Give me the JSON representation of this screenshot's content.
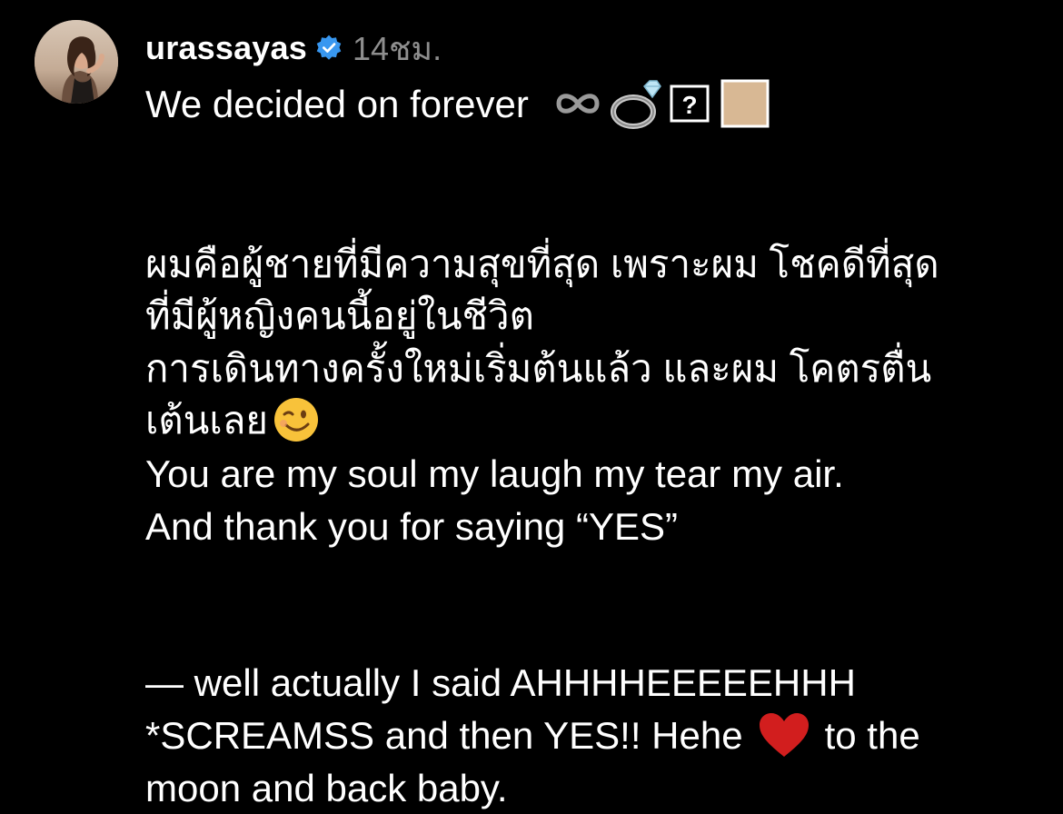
{
  "post": {
    "username": "urassayas",
    "time": "14ชม.",
    "verified_icon": "verified-badge-icon",
    "colors": {
      "background": "#000000",
      "text": "#ffffff",
      "muted": "#8e8e8e",
      "verified": "#3897f0",
      "heart": "#d21e1e"
    }
  },
  "caption": {
    "line1": "We decided on forever",
    "para2_line1": "ผมคือผู้ชายที่มีความสุขที่สุด เพราะผม โชคดีที่สุด",
    "para2_line2": "ที่มีผู้หญิงคนนี้อยู่ในชีวิต",
    "para3_line1": "การเดินทางครั้งใหม่เริ่มต้นแล้ว และผม โคตรตื่น",
    "para3_line2": "เต้นเลย",
    "para4_line1": "You are my soul my laugh my tear my air.",
    "para4_line2": "And thank you for saying “YES”",
    "para5_line1": "— well actually I said AHHHHEEEEEHHH",
    "para5_line2_a": "*SCREAMSS and then YES!! Hehe",
    "para5_line2_b": "to the",
    "para5_line3": "moon and back baby."
  },
  "icons": {
    "infinity": "infinity-icon",
    "ring": "ring-icon",
    "unknown_glyph": "unknown-glyph-icon",
    "skin_tone": "skin-tone-swatch-icon",
    "wink": "wink-face-icon",
    "heart": "red-heart-icon"
  }
}
